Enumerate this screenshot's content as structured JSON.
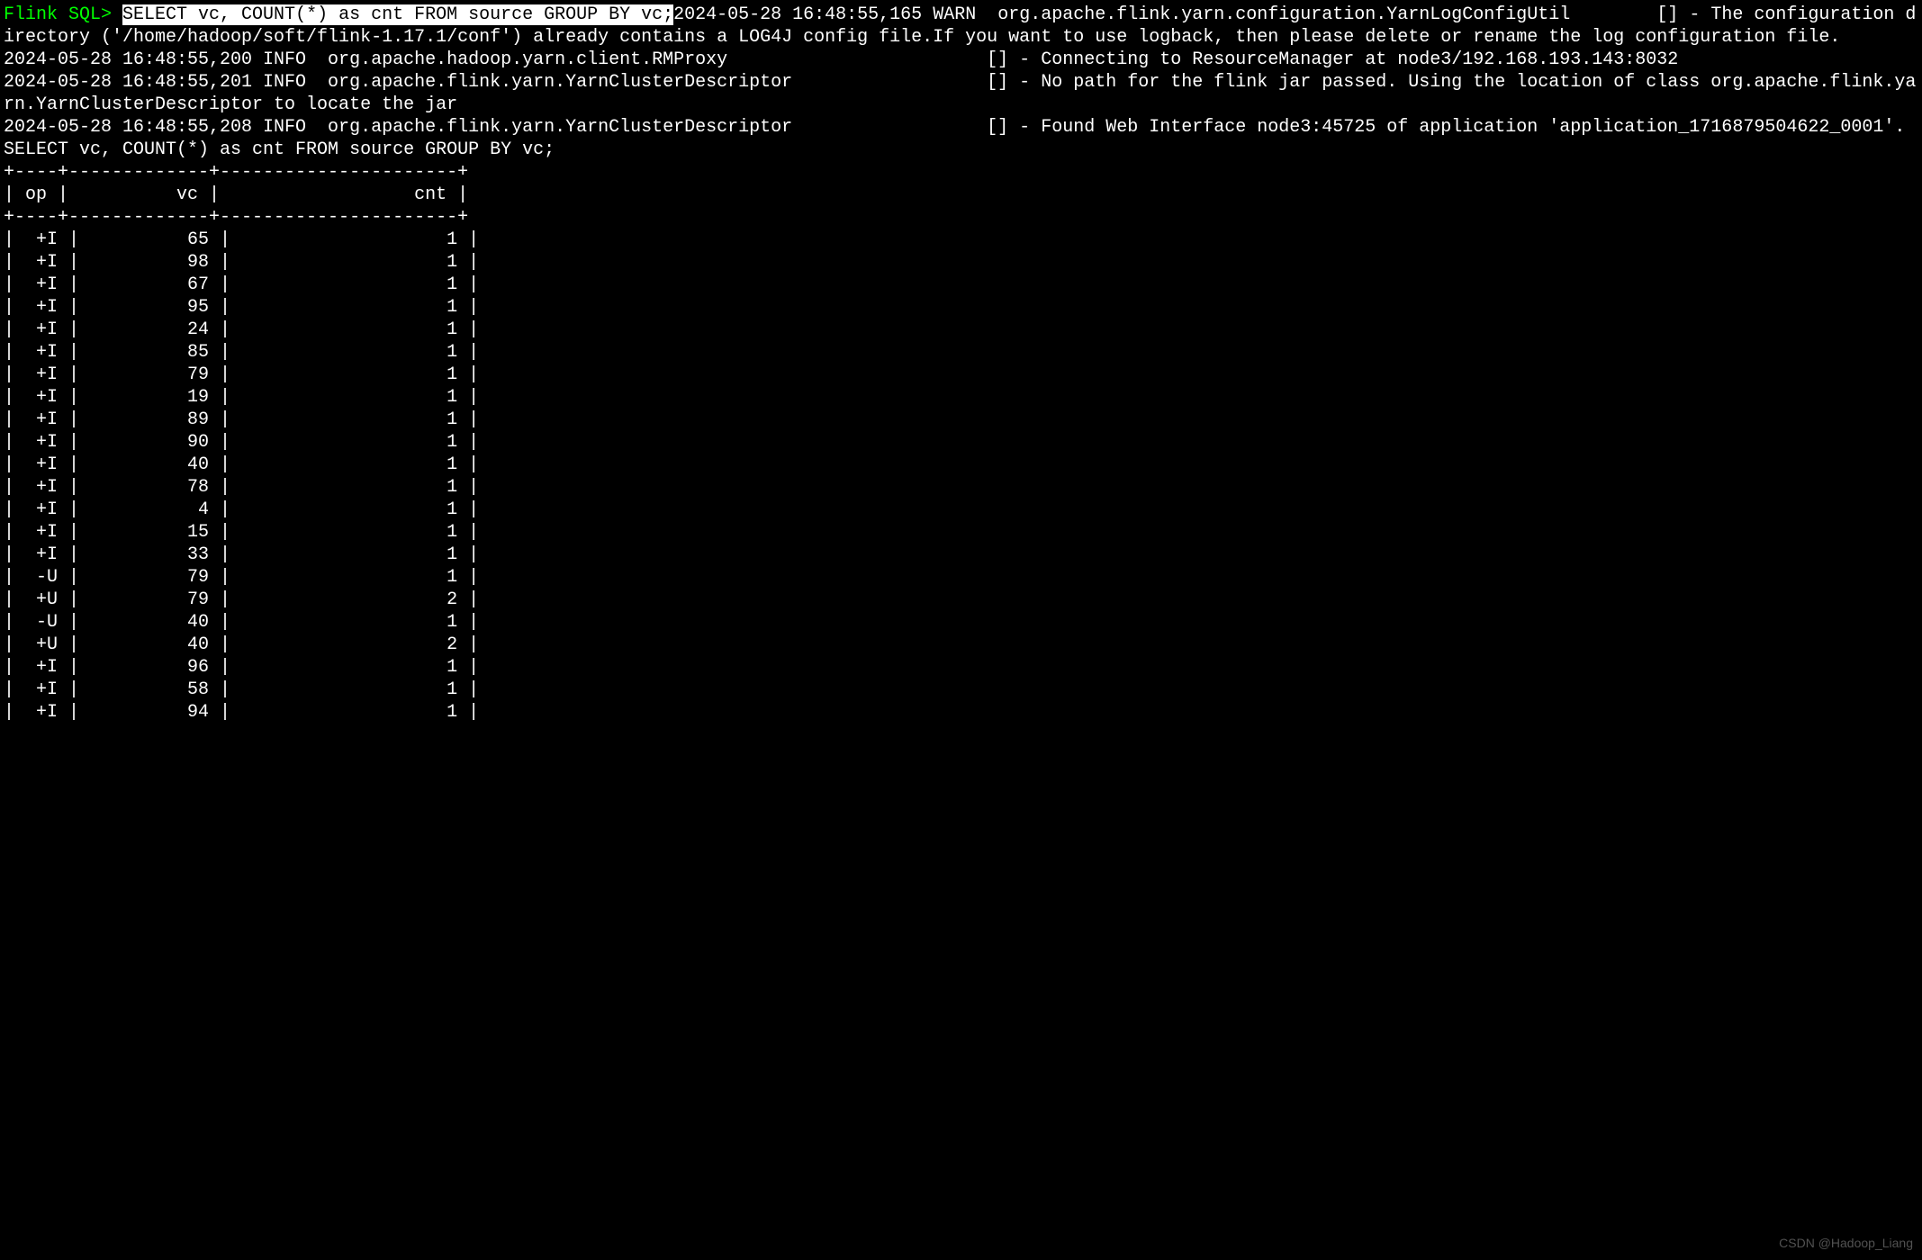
{
  "prompt": "Flink SQL> ",
  "sql_command": "SELECT vc, COUNT(*) as cnt FROM source GROUP BY vc;",
  "log_lines": [
    "2024-05-28 16:48:55,165 WARN  org.apache.flink.yarn.configuration.YarnLogConfigUtil        [] - The configuration directory ('/home/hadoop/soft/flink-1.17.1/conf') already contains a LOG4J config file.If you want to use logback, then please delete or rename the log configuration file.",
    "2024-05-28 16:48:55,200 INFO  org.apache.hadoop.yarn.client.RMProxy                        [] - Connecting to ResourceManager at node3/192.168.193.143:8032",
    "2024-05-28 16:48:55,201 INFO  org.apache.flink.yarn.YarnClusterDescriptor                  [] - No path for the flink jar passed. Using the location of class org.apache.flink.yarn.YarnClusterDescriptor to locate the jar",
    "2024-05-28 16:48:55,208 INFO  org.apache.flink.yarn.YarnClusterDescriptor                  [] - Found Web Interface node3:45725 of application 'application_1716879504622_0001'."
  ],
  "echoed_sql": "SELECT vc, COUNT(*) as cnt FROM source GROUP BY vc;",
  "table": {
    "border_top": "+----+-------------+----------------------+",
    "header_row": "| op |          vc |                  cnt |",
    "border_mid": "+----+-------------+----------------------+",
    "columns": [
      "op",
      "vc",
      "cnt"
    ],
    "rows": [
      {
        "op": "+I",
        "vc": "65",
        "cnt": "1"
      },
      {
        "op": "+I",
        "vc": "98",
        "cnt": "1"
      },
      {
        "op": "+I",
        "vc": "67",
        "cnt": "1"
      },
      {
        "op": "+I",
        "vc": "95",
        "cnt": "1"
      },
      {
        "op": "+I",
        "vc": "24",
        "cnt": "1"
      },
      {
        "op": "+I",
        "vc": "85",
        "cnt": "1"
      },
      {
        "op": "+I",
        "vc": "79",
        "cnt": "1"
      },
      {
        "op": "+I",
        "vc": "19",
        "cnt": "1"
      },
      {
        "op": "+I",
        "vc": "89",
        "cnt": "1"
      },
      {
        "op": "+I",
        "vc": "90",
        "cnt": "1"
      },
      {
        "op": "+I",
        "vc": "40",
        "cnt": "1"
      },
      {
        "op": "+I",
        "vc": "78",
        "cnt": "1"
      },
      {
        "op": "+I",
        "vc": "4",
        "cnt": "1"
      },
      {
        "op": "+I",
        "vc": "15",
        "cnt": "1"
      },
      {
        "op": "+I",
        "vc": "33",
        "cnt": "1"
      },
      {
        "op": "-U",
        "vc": "79",
        "cnt": "1"
      },
      {
        "op": "+U",
        "vc": "79",
        "cnt": "2"
      },
      {
        "op": "-U",
        "vc": "40",
        "cnt": "1"
      },
      {
        "op": "+U",
        "vc": "40",
        "cnt": "2"
      },
      {
        "op": "+I",
        "vc": "96",
        "cnt": "1"
      },
      {
        "op": "+I",
        "vc": "58",
        "cnt": "1"
      },
      {
        "op": "+I",
        "vc": "94",
        "cnt": "1"
      }
    ]
  },
  "watermark": "CSDN @Hadoop_Liang"
}
